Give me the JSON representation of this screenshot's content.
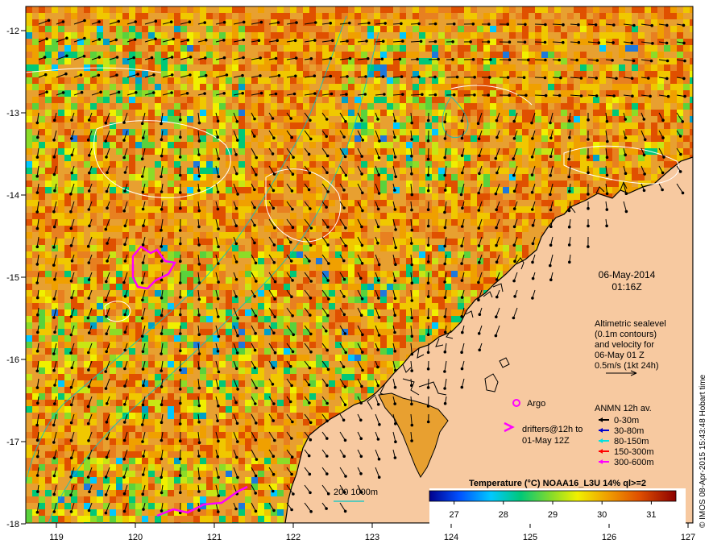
{
  "date": "06-May-2014",
  "time": "01:16Z",
  "altimetry": [
    "Altimetric sealevel",
    "(0.1m contours)",
    "and velocity for",
    "06-May 01 Z",
    "0.5m/s (1kt 24h)"
  ],
  "argo_label": "Argo",
  "drifters": [
    "drifters@12h to",
    "01-May 12Z"
  ],
  "anmn_title": "ANMN 12h av.",
  "anmn_legend": [
    {
      "label": "0-30m",
      "color": "#000000"
    },
    {
      "label": "30-80m",
      "color": "#0000cc"
    },
    {
      "label": "80-150m",
      "color": "#00e0e0"
    },
    {
      "label": "150-300m",
      "color": "#ff0000"
    },
    {
      "label": "300-600m",
      "color": "#ff00ff"
    }
  ],
  "colorbar_title": "Temperature (°C) NOAA16_L3U 14% ql>=2",
  "colorbar_ticks": [
    "27",
    "28",
    "29",
    "30",
    "31"
  ],
  "colorbar_range": [
    26.5,
    31.5
  ],
  "depth_legend": "200  1000m",
  "credit": "© IMOS 08-Apr-2015 15:43:48 Hobart time",
  "lon_ticks": [
    "119",
    "120",
    "121",
    "122",
    "123",
    "124",
    "125",
    "126",
    "127"
  ],
  "lat_ticks": [
    "-12",
    "-13",
    "-14",
    "-15",
    "-16",
    "-17",
    "-18"
  ],
  "colors": {
    "land": "#f7c9a0",
    "coast": "#000000",
    "contour": "#ffffff",
    "isobath": "#00c8c8",
    "argo": "#ff00ff"
  }
}
